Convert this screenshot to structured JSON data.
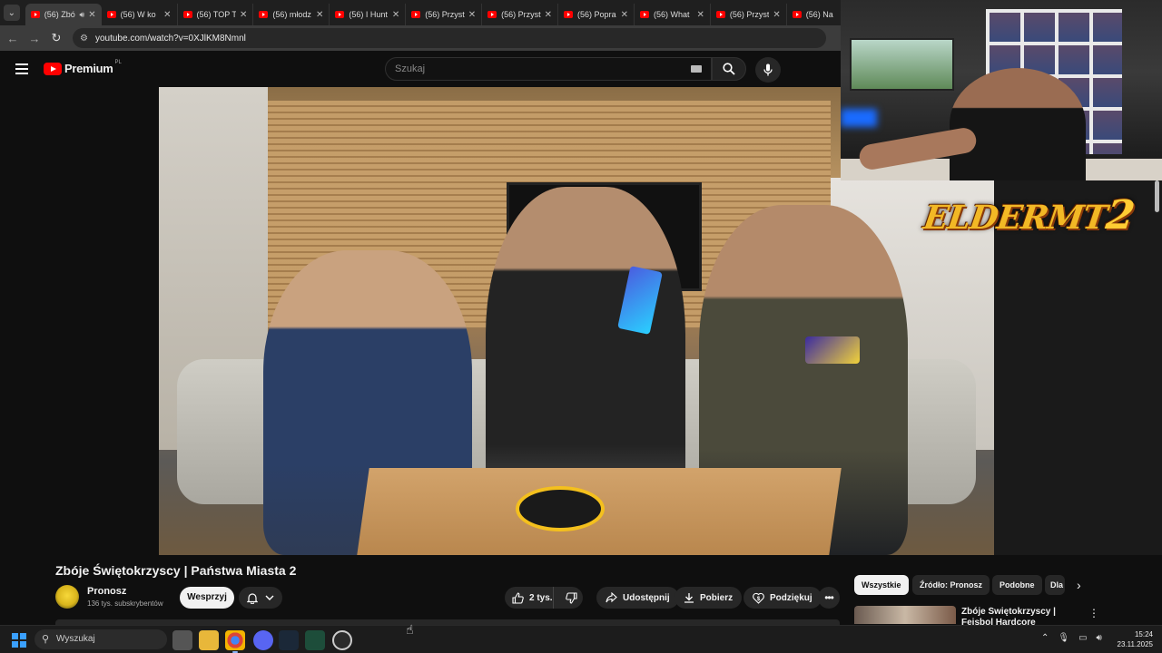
{
  "browser": {
    "tabs": [
      {
        "label": "(56) Zbó",
        "active": true,
        "speaker": true
      },
      {
        "label": "(56) W ko"
      },
      {
        "label": "(56) TOP T"
      },
      {
        "label": "(56) młodz"
      },
      {
        "label": "(56) I Hunt"
      },
      {
        "label": "(56) Przyst"
      },
      {
        "label": "(56) Przyst"
      },
      {
        "label": "(56) Popra"
      },
      {
        "label": "(56) What"
      },
      {
        "label": "(56) Przyst"
      },
      {
        "label": "(56) Na"
      }
    ],
    "url": "youtube.com/watch?v=0XJlKM8Nmnl"
  },
  "youtube": {
    "logo_text": "Premium",
    "region": "PL",
    "search_placeholder": "Szukaj"
  },
  "overlay": {
    "logo_text": "ELDERMT",
    "logo_number": "2"
  },
  "video": {
    "title": "Zbóje Świętokrzyscy | Państwa Miasta 2",
    "channel_name": "Pronosz",
    "subscribers": "136 tys. subskrybentów",
    "support_label": "Wesprzyj",
    "likes": "2 tys.",
    "share_label": "Udostępnij",
    "download_label": "Pobierz",
    "thanks_label": "Podziękuj"
  },
  "chips": {
    "all": "Wszystkie",
    "source": "Źródło: Pronosz",
    "similar": "Podobne",
    "for_you": "Dla"
  },
  "recommendation": {
    "title": "Zbóje Świętokrzyscy | Fejsbol Hardcore"
  },
  "taskbar": {
    "search_placeholder": "Wyszukaj",
    "time": "15:24",
    "date": "23.11.2025"
  },
  "colors": {
    "youtube_red": "#ff0000",
    "background": "#0f0f0f",
    "pill": "#272727",
    "logo_gold": "#f2b825"
  }
}
